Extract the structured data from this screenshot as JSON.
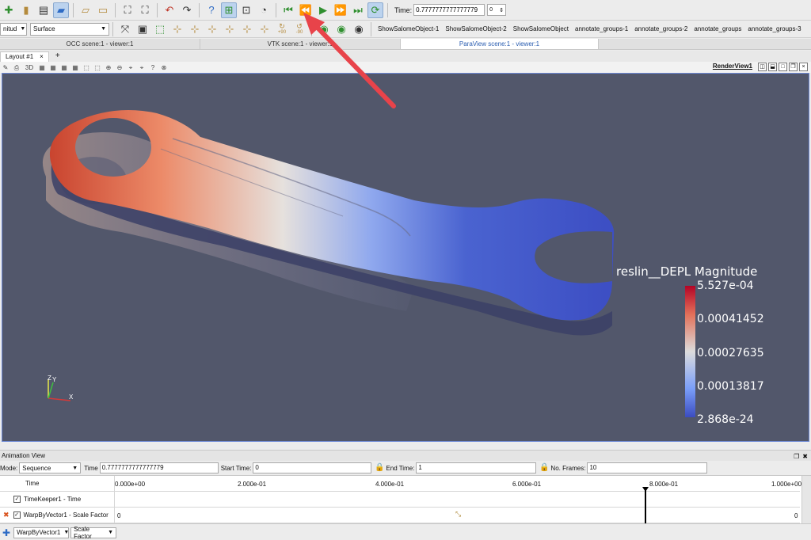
{
  "toolbar1": {
    "time_label": "Time:",
    "time_value": "0.7777777777777779",
    "time_index": "0"
  },
  "toolbar2": {
    "variable_select": "nitud",
    "representation_select": "Surface",
    "rot_plus": "+90",
    "rot_minus": "-90",
    "macros": [
      "ShowSalomeObject-1",
      "ShowSalomeObject-2",
      "ShowSalomeObject",
      "annotate_groups-1",
      "annotate_groups-2",
      "annotate_groups",
      "annotate_groups-3"
    ]
  },
  "view_tabs": [
    {
      "label": "OCC scene:1 - viewer:1"
    },
    {
      "label": "VTK scene:1 - viewer:1"
    },
    {
      "label": "ParaView scene:1 - viewer:1"
    }
  ],
  "layout_tab": {
    "label": "Layout #1",
    "close": "×",
    "add": "+"
  },
  "render_view": {
    "name": "RenderView1",
    "mode_3d": "3D"
  },
  "colorbar": {
    "title": "reslin__DEPL Magnitude",
    "labels": [
      "5.527e-04",
      "0.00041452",
      "0.00027635",
      "0.00013817",
      "2.868e-24"
    ]
  },
  "axes": {
    "x": "X",
    "y": "Y",
    "z": "Z"
  },
  "animation": {
    "panel_title": "Animation View",
    "mode_label": "Mode:",
    "mode_value": "Sequence",
    "time_label": "Time",
    "time_value": "0.7777777777777779",
    "start_label": "Start Time:",
    "start_value": "0",
    "end_label": "End Time:",
    "end_value": "1",
    "frames_label": "No. Frames:",
    "frames_value": "10",
    "track_header": "Time",
    "ticks": [
      "0.000e+00",
      "2.000e-01",
      "4.000e-01",
      "6.000e-01",
      "8.000e-01",
      "1.000e+00"
    ],
    "current_time_fraction": 0.7778,
    "tracks": [
      {
        "label": "TimeKeeper1 - Time",
        "checked": "✓"
      },
      {
        "label": "WarpByVector1 - Scale Factor",
        "checked": "✓",
        "start": "0",
        "end": "0"
      }
    ],
    "add_source": "WarpByVector1",
    "add_property": "Scale Factor"
  },
  "colors": {
    "viewport_bg": "#52576b",
    "arrow": "#e8434a",
    "accent": "#2e6bc5"
  }
}
